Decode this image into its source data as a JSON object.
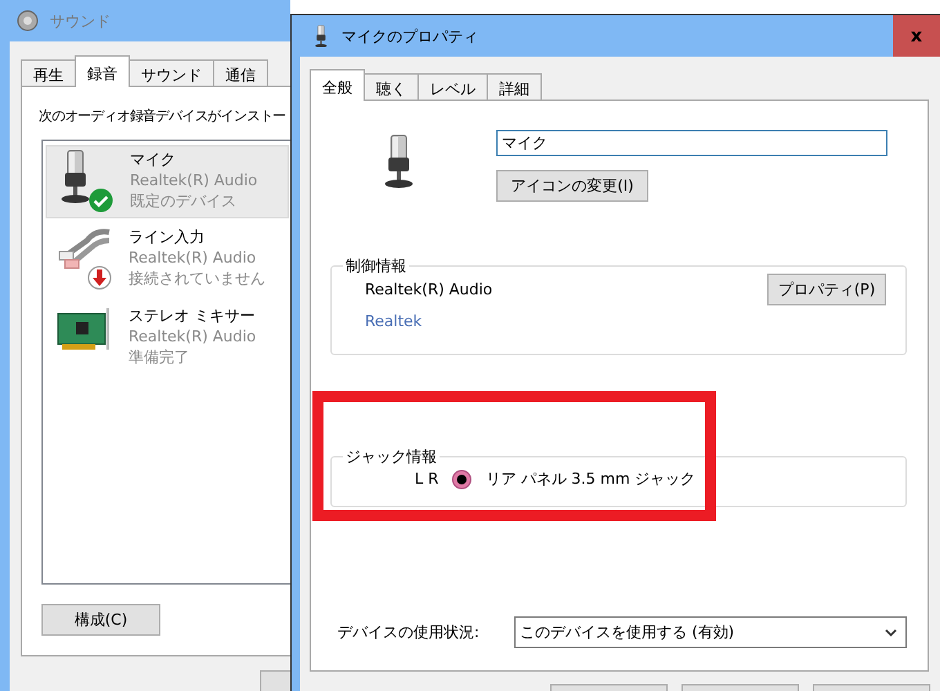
{
  "sound_window": {
    "title": "サウンド",
    "tabs": [
      {
        "label": "再生",
        "selected": false
      },
      {
        "label": "録音",
        "selected": true
      },
      {
        "label": "サウンド",
        "selected": false
      },
      {
        "label": "通信",
        "selected": false
      }
    ],
    "instruction": "次のオーディオ録音デバイスがインストー",
    "devices": [
      {
        "kind": "microphone",
        "name": "マイク",
        "driver": "Realtek(R) Audio",
        "status": "既定のデバイス",
        "default": true,
        "unplugged": false,
        "selected": true
      },
      {
        "kind": "line-in",
        "name": "ライン入力",
        "driver": "Realtek(R) Audio",
        "status": "接続されていません",
        "default": false,
        "unplugged": true,
        "selected": false
      },
      {
        "kind": "mixer",
        "name": "ステレオ ミキサー",
        "driver": "Realtek(R) Audio",
        "status": "準備完了",
        "default": false,
        "unplugged": false,
        "selected": false
      }
    ],
    "configure_button": "構成(C)"
  },
  "properties_window": {
    "title": "マイクのプロパティ",
    "close": "x",
    "tabs": [
      {
        "label": "全般",
        "selected": true
      },
      {
        "label": "聴く",
        "selected": false
      },
      {
        "label": "レベル",
        "selected": false
      },
      {
        "label": "詳細",
        "selected": false
      }
    ],
    "device_name": "マイク",
    "change_icon_button": "アイコンの変更(I)",
    "controller_group": {
      "title": "制御情報",
      "driver": "Realtek(R) Audio",
      "vendor_link": "Realtek",
      "properties_button": "プロパティ(P)"
    },
    "jack_group": {
      "title": "ジャック情報",
      "channels": "L R",
      "location": "リア パネル 3.5 mm ジャック"
    },
    "usage_label": "デバイスの使用状況:",
    "usage_value": "このデバイスを使用する (有効)"
  },
  "annotation": {
    "kind": "rectangle"
  }
}
